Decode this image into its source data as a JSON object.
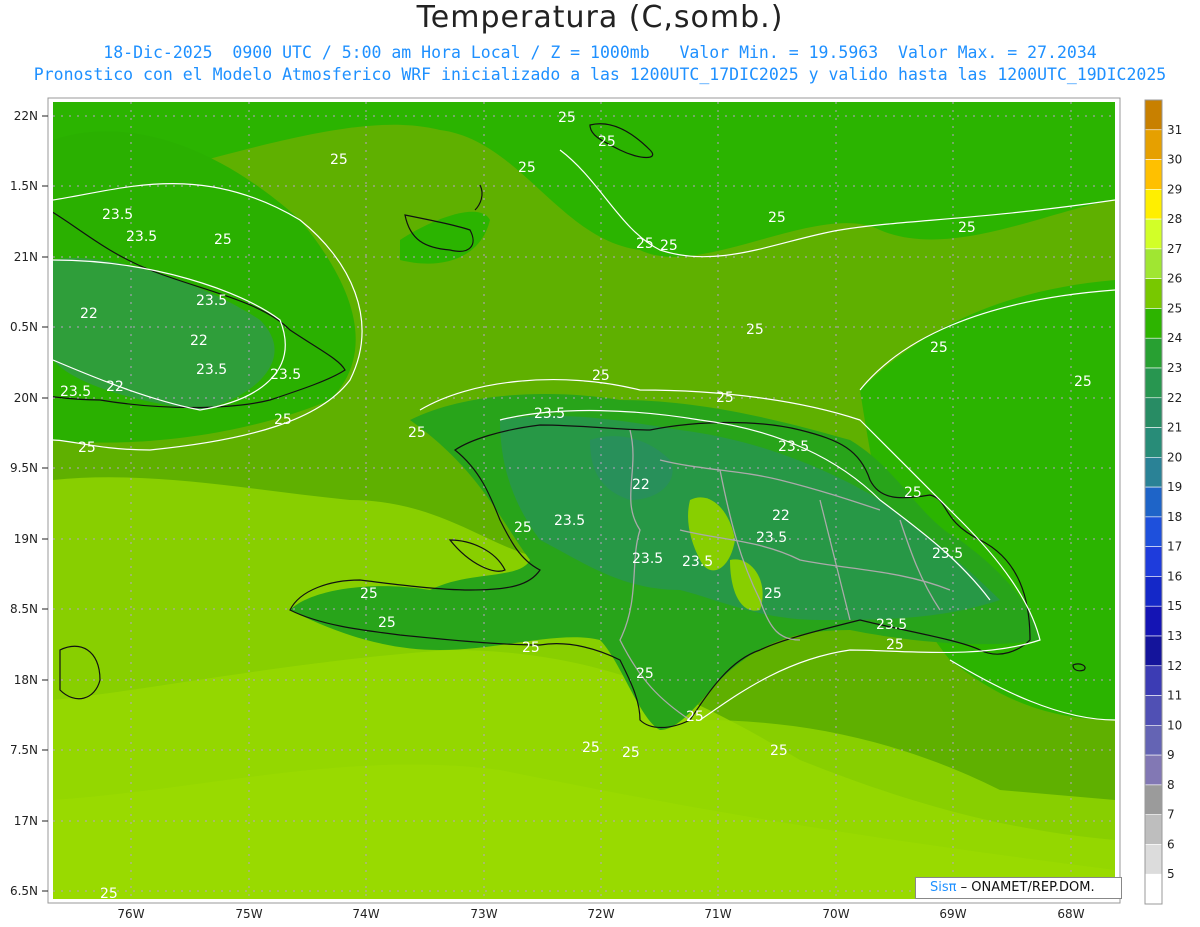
{
  "header": {
    "title": "Temperatura (C,somb.)",
    "line1": "18-Dic-2025  0900 UTC / 5:00 am Hora Local / Z = 1000mb   Valor Min. = 19.5963  Valor Max. = 27.2034",
    "line2": "Pronostico con el Modelo Atmosferico WRF inicializado a las 1200UTC_17DIC2025 y valido hasta las  1200UTC_19DIC2025"
  },
  "map": {
    "lat_labels": [
      "22N",
      "1.5N",
      "21N",
      "0.5N",
      "20N",
      "9.5N",
      "19N",
      "8.5N",
      "18N",
      "7.5N",
      "17N",
      "6.5N"
    ],
    "lon_labels": [
      "76W",
      "75W",
      "74W",
      "73W",
      "72W",
      "71W",
      "70W",
      "69W",
      "68W"
    ],
    "contour_labels": [
      "25",
      "23.5",
      "22"
    ],
    "grid": true,
    "land_contours": [
      "Cuba (east)",
      "Hispaniola",
      "Great Inagua",
      "Turks and Caicos",
      "Jamaica (east)"
    ]
  },
  "colorbar": {
    "levels": [
      "31",
      "30",
      "29",
      "28",
      "27",
      "26",
      "25",
      "24",
      "23",
      "22",
      "21",
      "20",
      "19",
      "18",
      "17",
      "16",
      "15",
      "13",
      "12",
      "11",
      "10",
      "9",
      "8",
      "7",
      "6",
      "5"
    ],
    "colors": [
      "#c88000",
      "#e6a000",
      "#ffc000",
      "#ffef00",
      "#d2ff28",
      "#a0e632",
      "#78c800",
      "#2db400",
      "#28a032",
      "#289650",
      "#288c64",
      "#288c78",
      "#2a8296",
      "#1e64c8",
      "#1e50dc",
      "#1e3cdc",
      "#1428c8",
      "#1414b4",
      "#14149b",
      "#3c3cb4",
      "#5050b4",
      "#6464b4",
      "#8278b4",
      "#9b9b9b",
      "#bebebe",
      "#dcdcdc",
      "#ffffff"
    ]
  },
  "credit": {
    "sis": "Sisπ",
    "org": "– ONAMET/REP.DOM."
  }
}
